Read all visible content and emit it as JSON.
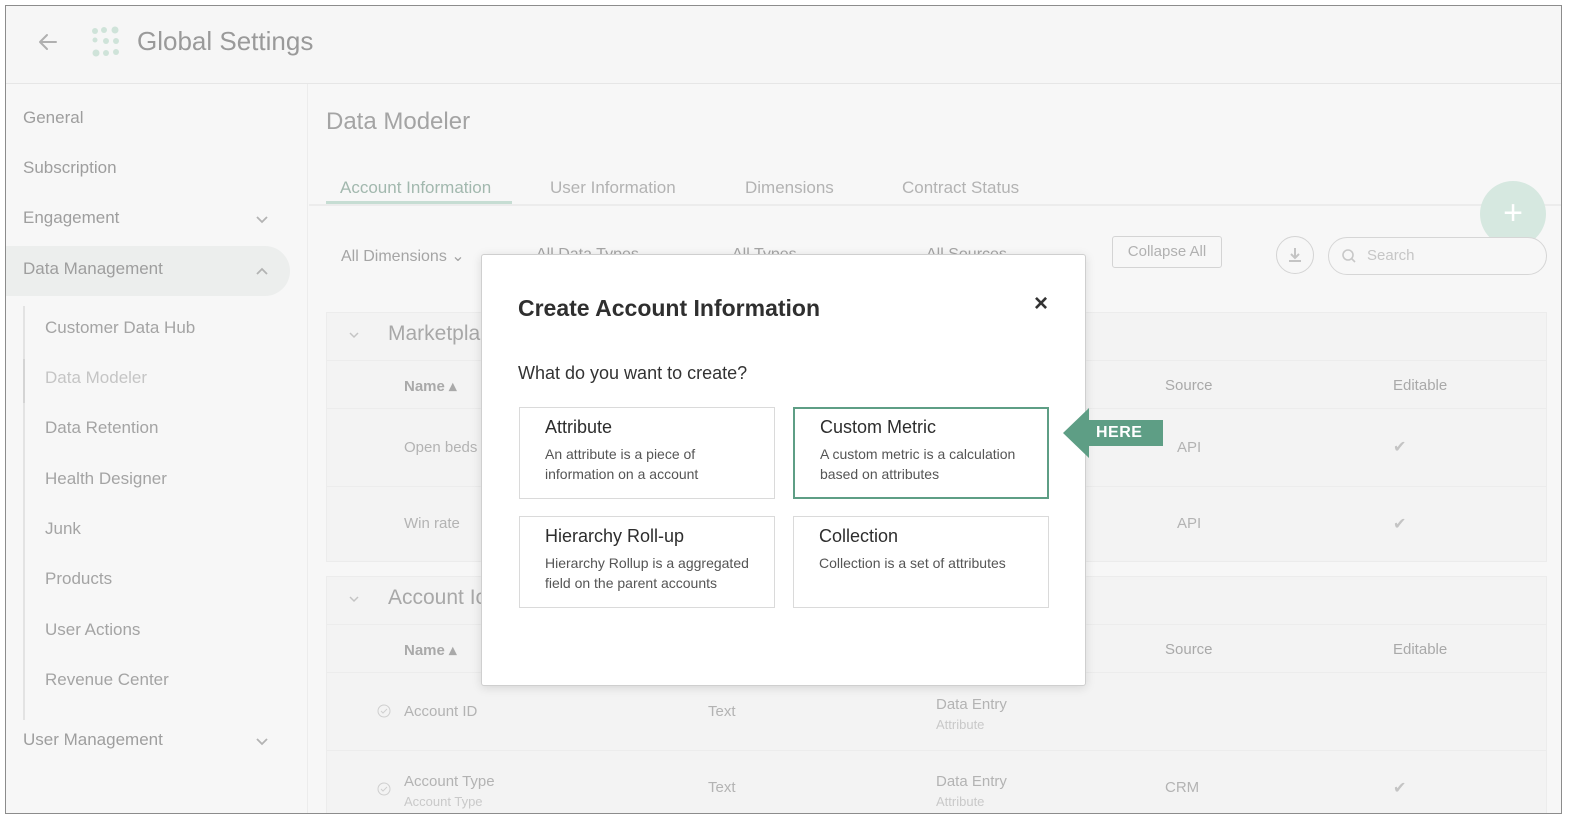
{
  "header": {
    "title": "Global Settings",
    "back_icon": "back-arrow-icon",
    "logo_icon": "dots-logo-icon"
  },
  "sidebar": {
    "items": [
      {
        "label": "General"
      },
      {
        "label": "Subscription"
      },
      {
        "label": "Engagement"
      },
      {
        "label": "Data Management"
      },
      {
        "label": "User Management"
      }
    ],
    "sub_items": [
      {
        "label": "Customer Data Hub"
      },
      {
        "label": "Data Modeler"
      },
      {
        "label": "Data Retention"
      },
      {
        "label": "Health Designer"
      },
      {
        "label": "Junk"
      },
      {
        "label": "Products"
      },
      {
        "label": "User Actions"
      },
      {
        "label": "Revenue Center"
      }
    ]
  },
  "main": {
    "title": "Data Modeler",
    "tabs": [
      {
        "label": "Account Information"
      },
      {
        "label": "User Information"
      },
      {
        "label": "Dimensions"
      },
      {
        "label": "Contract Status"
      }
    ],
    "filters": {
      "dimensions": "All Dimensions",
      "data_types": "All Data Types",
      "types": "All Types",
      "sources": "All Sources",
      "collapse": "Collapse All",
      "search_placeholder": "Search"
    },
    "fab_label": "+",
    "sections": [
      {
        "title": "Marketpla",
        "headers": {
          "name": "Name",
          "source": "Source",
          "editable": "Editable"
        },
        "rows": [
          {
            "name": "Open beds",
            "source": "API",
            "editable": "✔"
          },
          {
            "name": "Win rate",
            "source": "API",
            "editable": "✔"
          }
        ]
      },
      {
        "title": "Account Ic",
        "headers": {
          "name": "Name",
          "source": "Source",
          "editable": "Editable"
        },
        "rows": [
          {
            "name": "Account ID",
            "type": "Text",
            "data": "Data Entry",
            "data_sub": "Attribute",
            "source": "",
            "editable": ""
          },
          {
            "name": "Account Type",
            "name_sub": "Account Type",
            "type": "Text",
            "data": "Data Entry",
            "data_sub": "Attribute",
            "source": "CRM",
            "editable": "✔"
          }
        ]
      }
    ]
  },
  "modal": {
    "title": "Create Account Information",
    "close": "×",
    "question": "What do you want to create?",
    "options": [
      {
        "title": "Attribute",
        "desc": "An attribute is a piece of information on a account",
        "selected": false
      },
      {
        "title": "Custom Metric",
        "desc": "A custom metric is a calculation based on attributes",
        "selected": true
      },
      {
        "title": "Hierarchy Roll-up",
        "desc": "Hierarchy Rollup is a aggregated field on the parent accounts",
        "selected": false
      },
      {
        "title": "Collection",
        "desc": "Collection is a set of attributes",
        "selected": false
      }
    ]
  },
  "callout": {
    "label": "HERE",
    "color": "#5e9e85"
  },
  "colors": {
    "accent": "#5e9e85",
    "fab": "#d6e8e0"
  }
}
